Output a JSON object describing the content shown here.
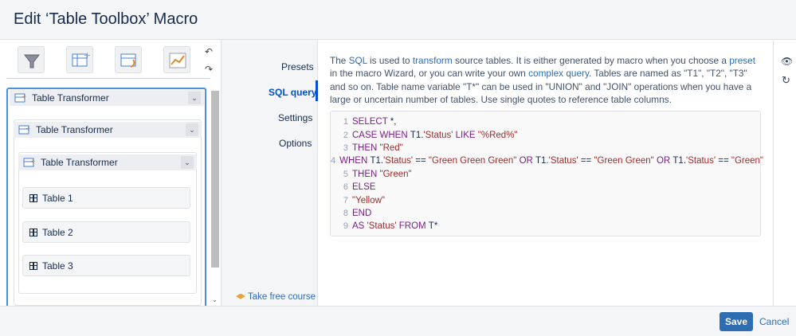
{
  "dialog": {
    "title": "Edit ‘Table Toolbox’ Macro"
  },
  "toolbar": {
    "icons": [
      "filter-icon",
      "table-add-icon",
      "table-transform-icon",
      "chart-icon"
    ],
    "undo_icon": "↶",
    "redo_icon": "↷"
  },
  "tree": {
    "level1": {
      "label": "Table Transformer",
      "chevron": "⌄"
    },
    "level2": {
      "label": "Table Transformer",
      "chevron": "⌄"
    },
    "level3": {
      "label": "Table Transformer",
      "chevron": "⌄"
    },
    "tables": [
      "Table 1",
      "Table 2",
      "Table 3"
    ],
    "scroll_down": "⌄"
  },
  "nav": {
    "items": [
      "Presets",
      "SQL query",
      "Settings",
      "Options"
    ],
    "active": "SQL query",
    "course_link": "Take free course"
  },
  "description": {
    "p1": "The ",
    "sql": "SQL",
    "p2": " is used to ",
    "transform": "transform",
    "p3": " source tables. It is either generated by macro when you choose a ",
    "preset": "preset",
    "p4": " in the macro Wizard, or you can write your own ",
    "complex": "complex query",
    "p5": ". Tables are named as \"T1\", \"T2\", \"T3\" and so on. Table name variable \"T*\" can be used in \"UNION\" and \"JOIN\" operations when you have a large or uncertain number of tables. Use single quotes to reference table columns."
  },
  "sql_lines": [
    [
      [
        "kw",
        "SELECT "
      ],
      [
        "plain",
        "*,"
      ]
    ],
    [
      [
        "kw",
        "CASE WHEN "
      ],
      [
        "plain",
        "T1."
      ],
      [
        "str",
        "'Status'"
      ],
      [
        "kw",
        " LIKE "
      ],
      [
        "str",
        "\"%Red%\""
      ]
    ],
    [
      [
        "kw",
        "THEN "
      ],
      [
        "str",
        "\"Red\""
      ]
    ],
    [
      [
        "kw",
        "WHEN "
      ],
      [
        "plain",
        "T1."
      ],
      [
        "str",
        "'Status'"
      ],
      [
        "plain",
        " == "
      ],
      [
        "str",
        "\"Green Green Green\""
      ],
      [
        "kw",
        " OR "
      ],
      [
        "plain",
        "T1."
      ],
      [
        "str",
        "'Status'"
      ],
      [
        "plain",
        " == "
      ],
      [
        "str",
        "\"Green Green\""
      ],
      [
        "kw",
        " OR "
      ],
      [
        "plain",
        "T1."
      ],
      [
        "str",
        "'Status'"
      ],
      [
        "plain",
        " == "
      ],
      [
        "str",
        "\"Green\""
      ]
    ],
    [
      [
        "kw",
        "THEN "
      ],
      [
        "str",
        "\"Green\""
      ]
    ],
    [
      [
        "kw",
        "ELSE"
      ]
    ],
    [
      [
        "str",
        "\"Yellow\""
      ]
    ],
    [
      [
        "kw",
        "END"
      ]
    ],
    [
      [
        "kw",
        "AS "
      ],
      [
        "str",
        "'Status'"
      ],
      [
        "kw",
        " FROM "
      ],
      [
        "plain",
        "T*"
      ]
    ]
  ],
  "right_rail": {
    "preview_icon": "👁",
    "refresh_icon": "↻"
  },
  "footer": {
    "save_label": "Save",
    "cancel_label": "Cancel"
  },
  "colors": {
    "accent": "#0052cc",
    "save": "#2f6db3",
    "keyword": "#7a1f85",
    "string": "#a02b2b"
  }
}
